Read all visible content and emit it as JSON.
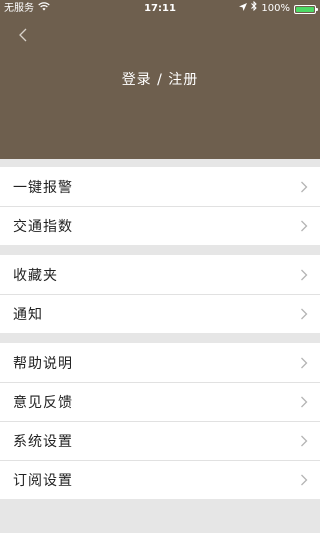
{
  "status_bar": {
    "carrier": "无服务",
    "time": "17:11",
    "battery": "100%"
  },
  "header": {
    "login_label": "登录 / 注册"
  },
  "menu_groups": [
    {
      "items": [
        {
          "label": "一键报警"
        },
        {
          "label": "交通指数"
        }
      ]
    },
    {
      "items": [
        {
          "label": "收藏夹"
        },
        {
          "label": "通知"
        }
      ]
    },
    {
      "items": [
        {
          "label": "帮助说明"
        },
        {
          "label": "意见反馈"
        },
        {
          "label": "系统设置"
        },
        {
          "label": "订阅设置"
        }
      ]
    }
  ],
  "colors": {
    "header_bg": "#6e5f4e",
    "page_bg": "#e6e6e6",
    "battery_green": "#4cd964"
  },
  "icons": [
    "wifi-icon",
    "location-arrow-icon",
    "bluetooth-icon",
    "battery-icon",
    "back-chevron-icon",
    "chevron-right-icon"
  ]
}
